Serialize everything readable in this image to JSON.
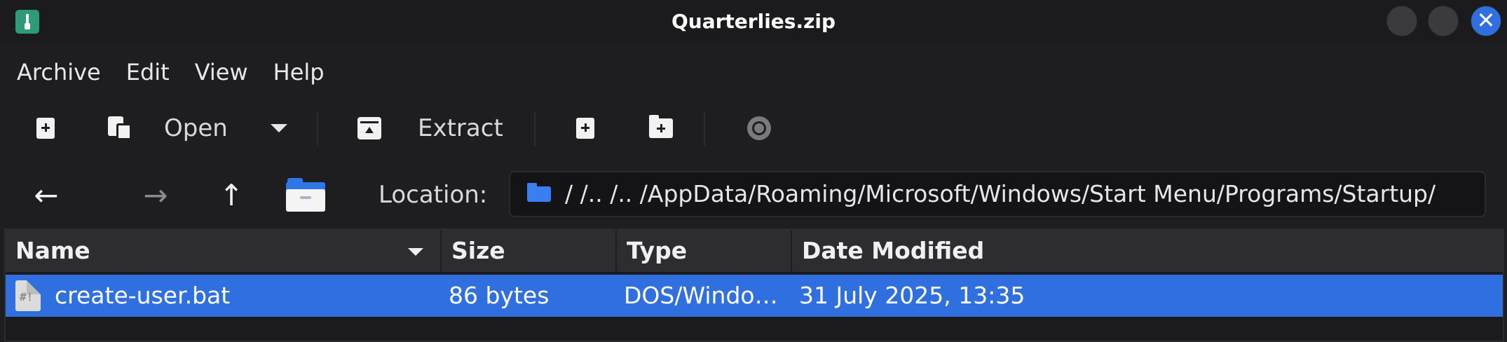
{
  "window": {
    "title": "Quarterlies.zip",
    "close_glyph": "✕"
  },
  "menu": [
    "Archive",
    "Edit",
    "View",
    "Help"
  ],
  "toolbar": {
    "open_label": "Open",
    "extract_label": "Extract"
  },
  "navigation": {
    "back_glyph": "←",
    "forward_glyph": "→",
    "up_glyph": "↑",
    "location_label": "Location:",
    "location_path": "/ /.. /.. /AppData/Roaming/Microsoft/Windows/Start Menu/Programs/Startup/"
  },
  "file_list": {
    "columns": [
      "Name",
      "Size",
      "Type",
      "Date Modified"
    ],
    "rows": [
      {
        "name": "create-user.bat",
        "size": "86 bytes",
        "type": "DOS/Windo…",
        "date_modified": "31 July 2025, 13:35",
        "icon_glyph": "#!",
        "selected": true
      }
    ]
  },
  "colors": {
    "selection": "#2f6fe0",
    "accent_close": "#2f6fe0",
    "app_icon": "#2f9a7a",
    "folder": "#2f76e8"
  }
}
